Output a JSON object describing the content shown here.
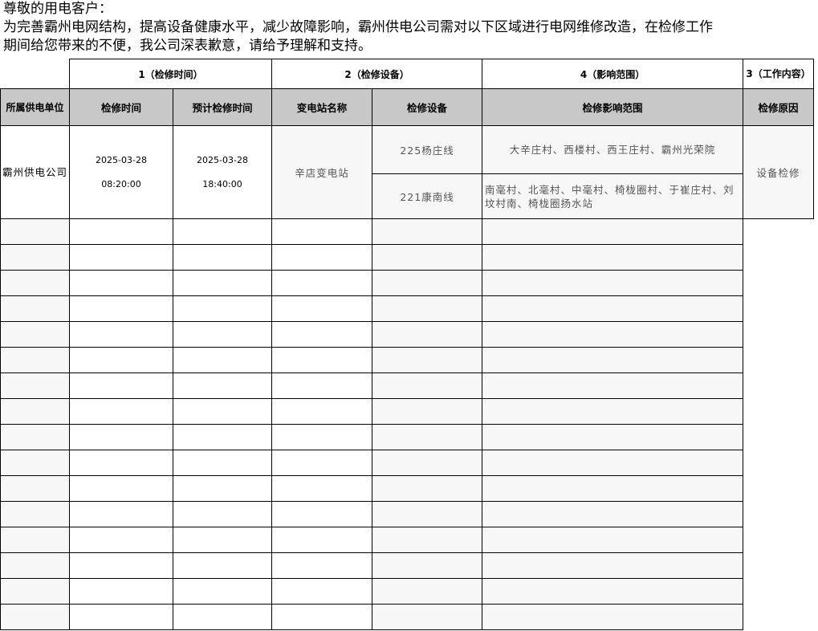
{
  "notice": {
    "greeting": "尊敬的用电客户：",
    "line1": "为完善霸州电网结构，提高设备健康水平，减少故障影响，霸州供电公司需对以下区域进行电网维修改造，在检修工作",
    "line2": "期间给您带来的不便，我公司深表歉意，请给予理解和支持。"
  },
  "sections": {
    "time": "1（检修时间）",
    "equipment": "2（检修设备）",
    "scope": "4（影响范围）",
    "work": "3（工作内容）"
  },
  "columns": {
    "unit": "所属供电单位",
    "start": "检修时间",
    "end": "预计检修时间",
    "substation": "变电站名称",
    "device": "检修设备",
    "scope": "检修影响范围",
    "reason": "检修原因"
  },
  "record": {
    "unit": "霸州供电公司",
    "start_date": "2025-03-28",
    "start_time": "08:20:00",
    "end_date": "2025-03-28",
    "end_time": "18:40:00",
    "substation": "辛店变电站",
    "devices": [
      {
        "name": "225杨庄线",
        "scope": "大辛庄村、西楼村、西王庄村、霸州光荣院"
      },
      {
        "name": "221康南线",
        "scope": "南毫村、北毫村、中毫村、椅栊圈村、于崔庄村、刘坟村南、椅栊圈扬水站"
      }
    ],
    "reason": "设备检修"
  }
}
